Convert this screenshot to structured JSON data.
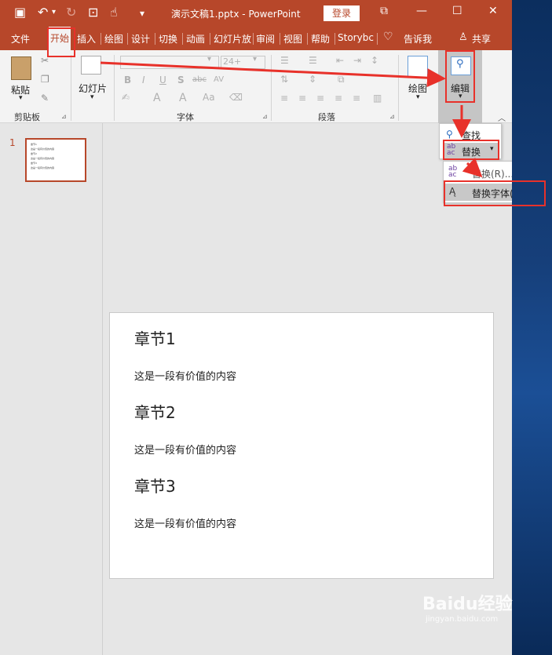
{
  "titlebar": {
    "save_icon": "save-icon",
    "undo_icon": "undo-icon",
    "redo_icon": "redo-icon",
    "title": "演示文稿1.pptx  -  PowerPoint",
    "login": "登录",
    "min": "—",
    "max": "☐",
    "close": "✕",
    "restore": "⧉"
  },
  "tabs": [
    "文件",
    "开始",
    "插入",
    "绘图",
    "设计",
    "切换",
    "动画",
    "幻灯片放",
    "审阅",
    "视图",
    "帮助",
    "Storybc"
  ],
  "tell_me": "告诉我",
  "share": "共享",
  "ribbon": {
    "paste": "粘贴",
    "clipboard": "剪贴板",
    "new_slide": "幻灯片",
    "font": "字体",
    "paragraph": "段落",
    "drawing": "绘图",
    "editing": "编辑",
    "font_size": "24+",
    "bold": "B",
    "italic": "I",
    "underline": "U",
    "shadow": "S",
    "strike": "abc",
    "spacing": "AV",
    "fontcolor": "A",
    "grow": "A",
    "change_case": "Aa"
  },
  "thumb": {
    "number": "1",
    "lines": [
      "章节1",
      "这是一段有价值的内容",
      "章节2",
      "这是一段有价值的内容",
      "章节3",
      "这是一段有价值的内容"
    ]
  },
  "slide": {
    "h1": "章节1",
    "p1": "这是一段有价值的内容",
    "h2": "章节2",
    "p2": "这是一段有价值的内容",
    "h3": "章节3",
    "p3": "这是一段有价值的内容"
  },
  "edit_menu": {
    "find": "查找",
    "replace": "替换",
    "replace_dd": "替换(R)...",
    "replace_fonts": "替换字体(O)..."
  },
  "watermark": {
    "brand": "Baidu经验",
    "url": "jingyan.baidu.com"
  },
  "colors": {
    "accent": "#b7472a",
    "highlight": "#e8312a"
  }
}
